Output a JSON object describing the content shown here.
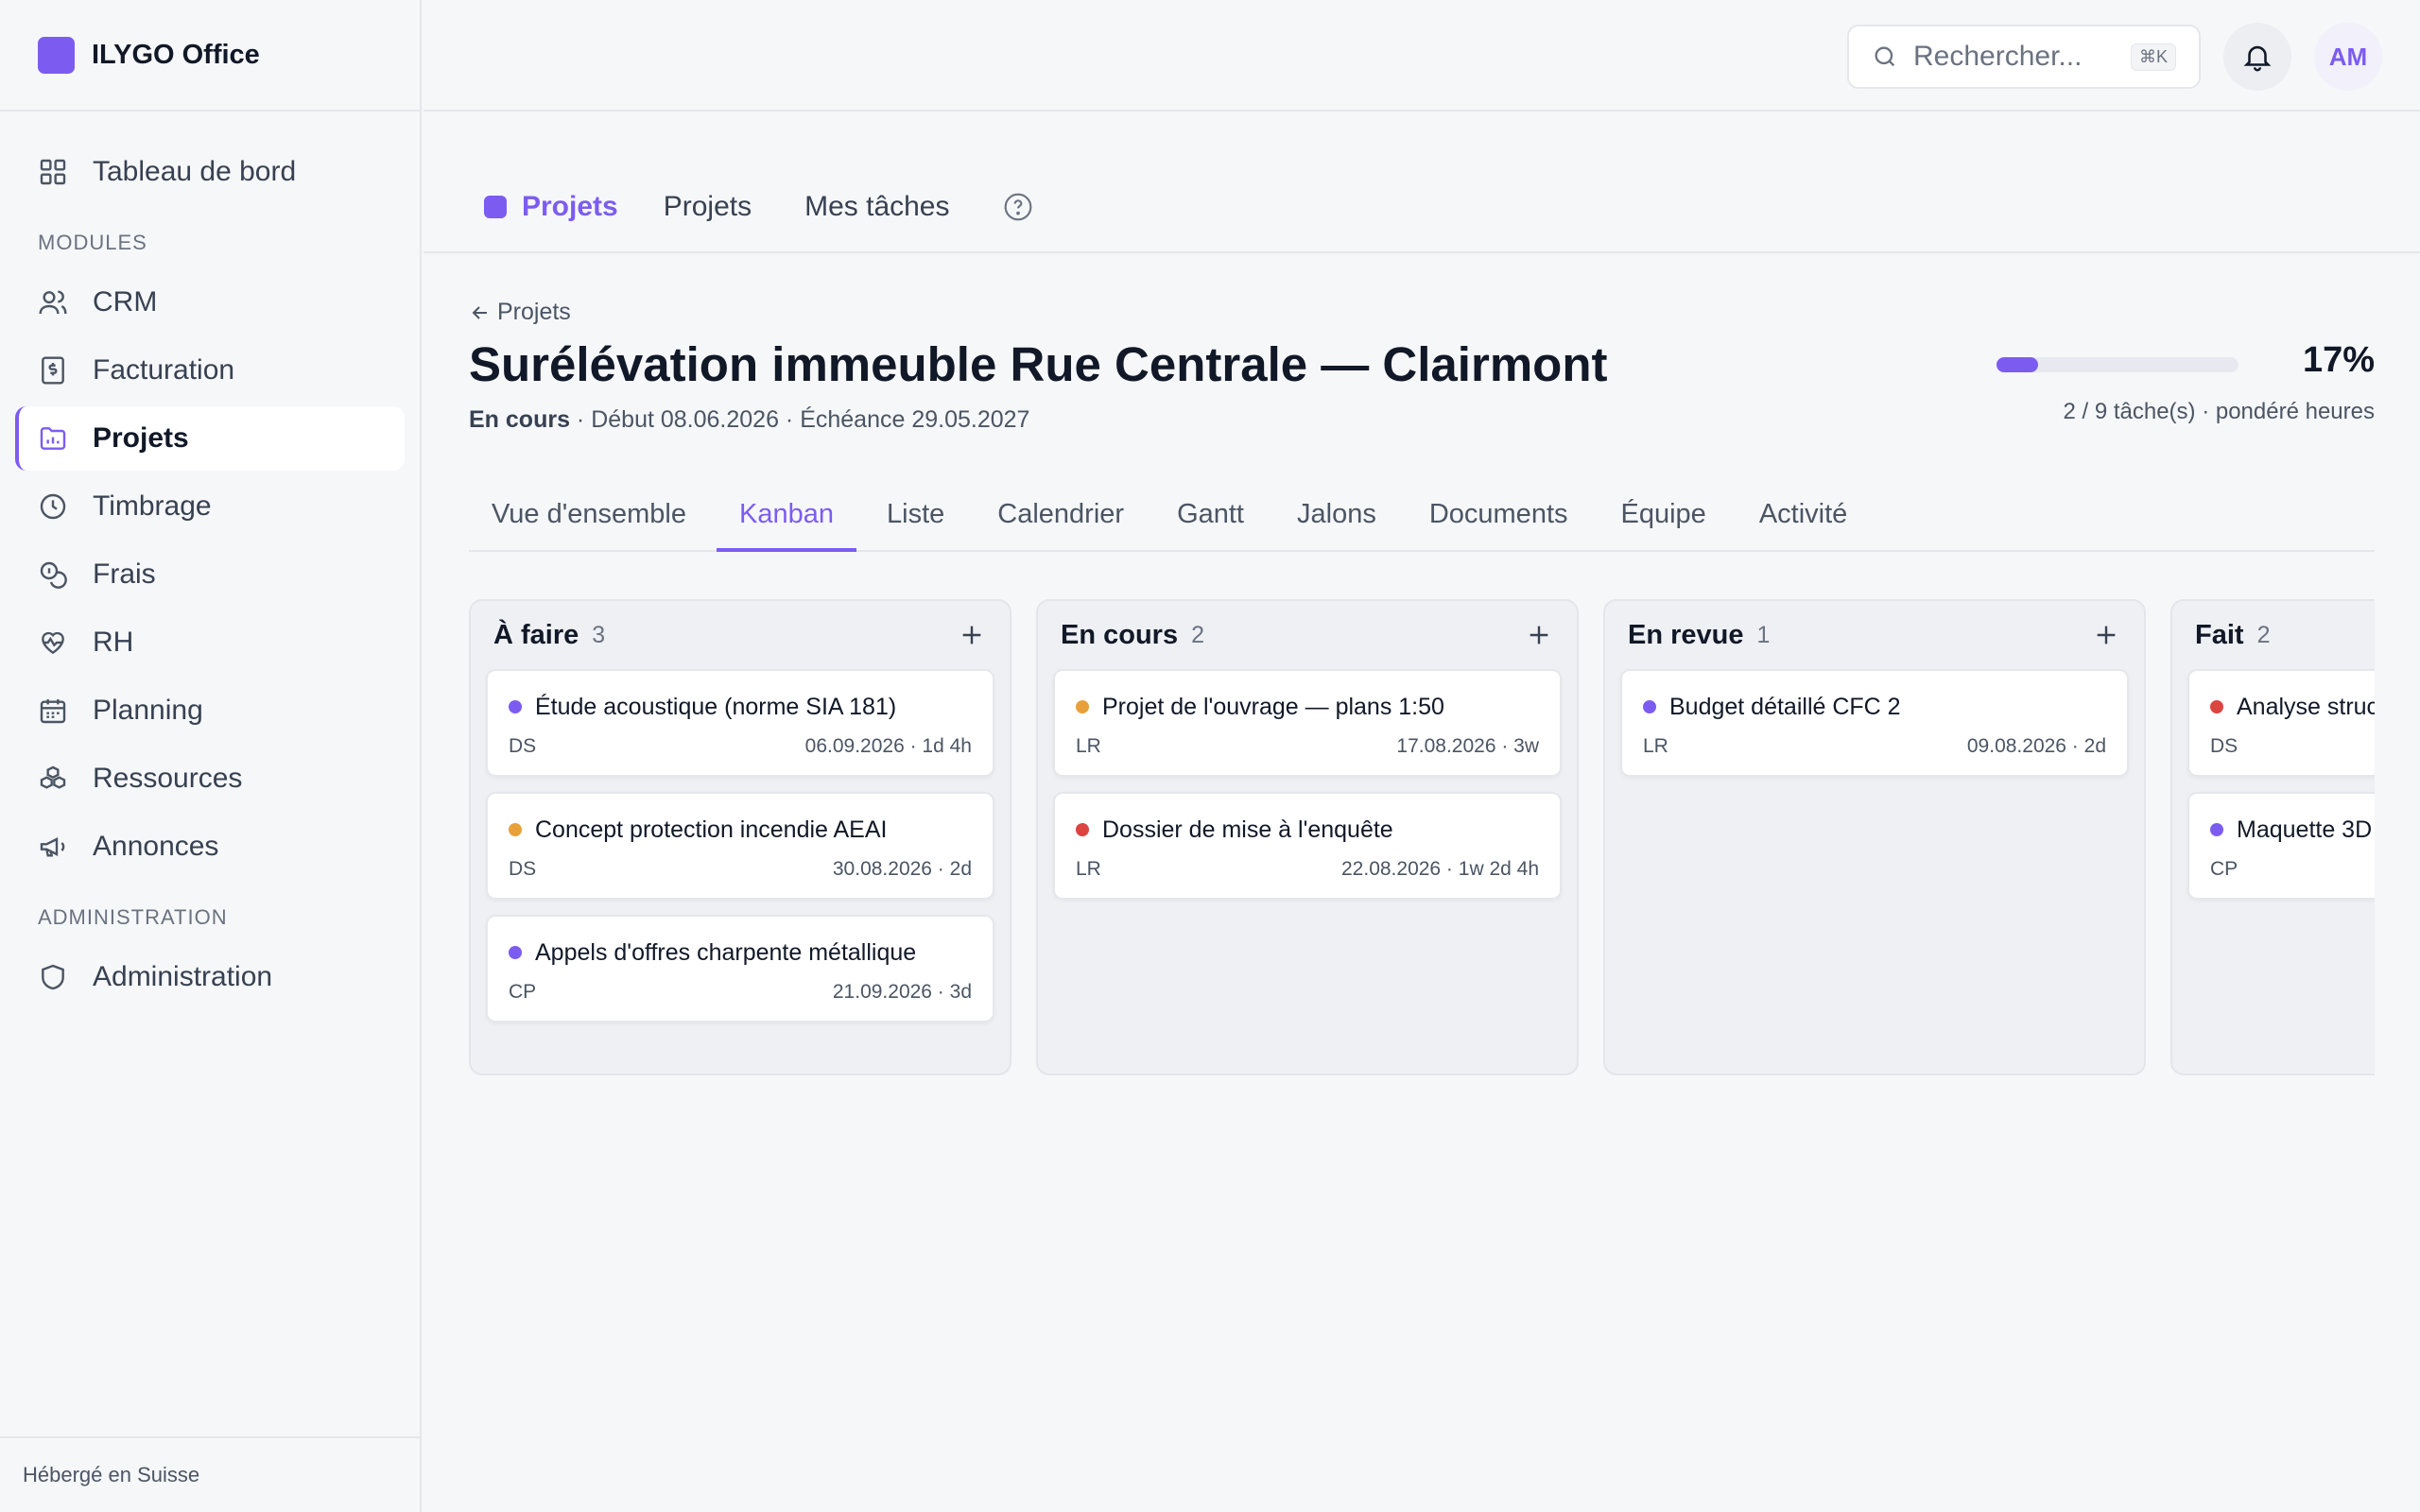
{
  "app": {
    "name": "ILYGO Office"
  },
  "sidebar": {
    "dashboard": {
      "label": "Tableau de bord"
    },
    "modules_title": "MODULES",
    "modules": [
      {
        "label": "CRM",
        "icon": "users-icon"
      },
      {
        "label": "Facturation",
        "icon": "invoice-icon"
      },
      {
        "label": "Projets",
        "icon": "folder-chart-icon",
        "active": true
      },
      {
        "label": "Timbrage",
        "icon": "clock-icon"
      },
      {
        "label": "Frais",
        "icon": "coins-icon"
      },
      {
        "label": "RH",
        "icon": "heart-pulse-icon"
      },
      {
        "label": "Planning",
        "icon": "calendar-icon"
      },
      {
        "label": "Ressources",
        "icon": "boxes-icon"
      },
      {
        "label": "Annonces",
        "icon": "megaphone-icon"
      }
    ],
    "admin_title": "ADMINISTRATION",
    "admin": {
      "label": "Administration",
      "icon": "shield-icon"
    },
    "footer": "Hébergé en Suisse"
  },
  "topbar": {
    "search_placeholder": "Rechercher...",
    "shortcut": "⌘K",
    "avatar": "AM"
  },
  "module": {
    "brand": "Projets",
    "links": [
      "Projets",
      "Mes tâches"
    ]
  },
  "project": {
    "back": "Projets",
    "title": "Surélévation immeuble Rue Centrale — Clairmont",
    "status": "En cours",
    "meta": " · Début 08.06.2026 · Échéance 29.05.2027",
    "progress": 0.17,
    "progress_label": "17%",
    "progress_sub": "2 / 9 tâche(s) · pondéré heures"
  },
  "subtabs": [
    {
      "label": "Vue d'ensemble"
    },
    {
      "label": "Kanban",
      "active": true
    },
    {
      "label": "Liste"
    },
    {
      "label": "Calendrier"
    },
    {
      "label": "Gantt"
    },
    {
      "label": "Jalons"
    },
    {
      "label": "Documents"
    },
    {
      "label": "Équipe"
    },
    {
      "label": "Activité"
    }
  ],
  "colors": {
    "accent": "#7c5cf0",
    "orange": "#e8a13a",
    "red": "#dc4440",
    "purple": "#7c5cf0"
  },
  "board": {
    "columns": [
      {
        "title": "À faire",
        "count": "3",
        "cards": [
          {
            "title": "Étude acoustique (norme SIA 181)",
            "dot": "purple",
            "assignee": "DS",
            "info": "06.09.2026 · 1d 4h"
          },
          {
            "title": "Concept protection incendie AEAI",
            "dot": "orange",
            "assignee": "DS",
            "info": "30.08.2026 · 2d"
          },
          {
            "title": "Appels d'offres charpente métallique",
            "dot": "purple",
            "assignee": "CP",
            "info": "21.09.2026 · 3d"
          }
        ]
      },
      {
        "title": "En cours",
        "count": "2",
        "cards": [
          {
            "title": "Projet de l'ouvrage — plans 1:50",
            "dot": "orange",
            "assignee": "LR",
            "info": "17.08.2026 · 3w"
          },
          {
            "title": "Dossier de mise à l'enquête",
            "dot": "red",
            "assignee": "LR",
            "info": "22.08.2026 · 1w 2d 4h"
          }
        ]
      },
      {
        "title": "En revue",
        "count": "1",
        "cards": [
          {
            "title": "Budget détaillé CFC 2",
            "dot": "purple",
            "assignee": "LR",
            "info": "09.08.2026 · 2d"
          }
        ]
      },
      {
        "title": "Fait",
        "count": "2",
        "cards": [
          {
            "title": "Analyse structure ingénieur",
            "dot": "red",
            "assignee": "DS",
            "info": ""
          },
          {
            "title": "Maquette 3D",
            "dot": "purple",
            "assignee": "CP",
            "info": ""
          }
        ]
      }
    ]
  }
}
